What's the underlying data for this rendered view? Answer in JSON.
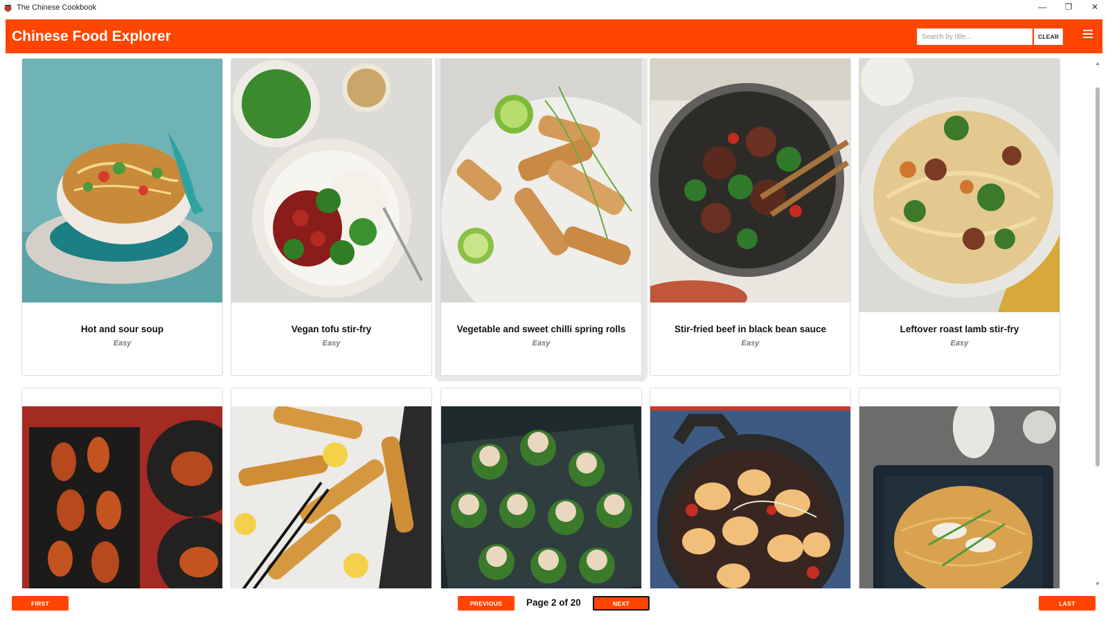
{
  "window": {
    "title": "The Chinese Cookbook",
    "controls": [
      "—",
      "❐",
      "✕"
    ]
  },
  "header": {
    "brand": "Chinese Food Explorer",
    "search_placeholder": "Search by title...",
    "clear_label": "CLEAR"
  },
  "recipes": [
    {
      "name": "Hot and sour soup",
      "difficulty": "Easy"
    },
    {
      "name": "Vegan tofu stir-fry",
      "difficulty": "Easy"
    },
    {
      "name": "Vegetable and sweet chilli spring rolls",
      "difficulty": "Easy"
    },
    {
      "name": "Stir-fried beef in black bean sauce",
      "difficulty": "Easy"
    },
    {
      "name": "Leftover roast lamb stir-fry",
      "difficulty": "Easy"
    }
  ],
  "pager": {
    "first": "FIRST",
    "previous": "PREVIOUS",
    "page_info": "Page 2 of 20",
    "next": "NEXT",
    "last": "LAST"
  }
}
